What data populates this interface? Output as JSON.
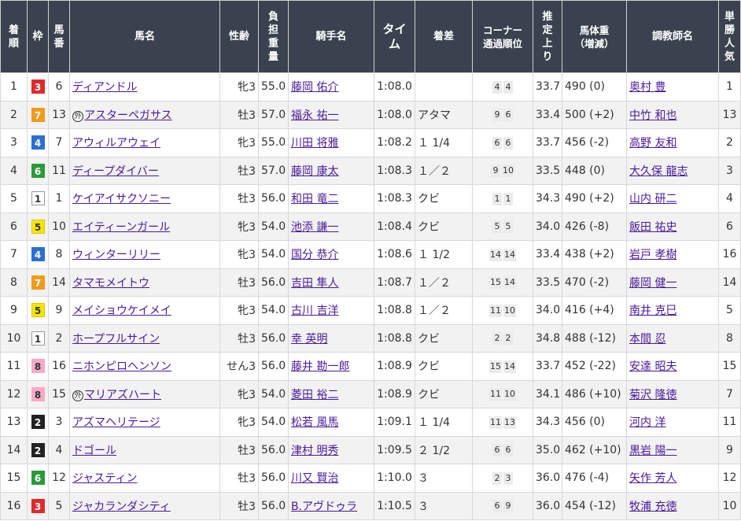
{
  "headers": {
    "rank": "着順",
    "frame": "枠",
    "num": "馬番",
    "horse": "馬名",
    "sexage": "性齢",
    "weight": "負担重量",
    "jockey": "騎手名",
    "time": "タイム",
    "margin": "着差",
    "corner": "コーナー\n通過順位",
    "last3f": "推定上り",
    "bodyweight": "馬体重\n（増減）",
    "trainer": "調教師名",
    "pop": "単勝人気"
  },
  "frame_colors": {
    "1": {
      "bg": "#ffffff",
      "fg": "#333333",
      "border": "#999999"
    },
    "2": {
      "bg": "#222222",
      "fg": "#ffffff",
      "border": "#222222"
    },
    "3": {
      "bg": "#e02a2a",
      "fg": "#ffffff",
      "border": "#e02a2a"
    },
    "4": {
      "bg": "#2a6fd6",
      "fg": "#ffffff",
      "border": "#2a6fd6"
    },
    "5": {
      "bg": "#f5e600",
      "fg": "#333333",
      "border": "#d8c800"
    },
    "6": {
      "bg": "#2a9a3a",
      "fg": "#ffffff",
      "border": "#2a9a3a"
    },
    "7": {
      "bg": "#f29a1a",
      "fg": "#ffffff",
      "border": "#f29a1a"
    },
    "8": {
      "bg": "#f7a8c8",
      "fg": "#333333",
      "border": "#f7a8c8"
    }
  },
  "gaisha_mark": "外",
  "rows": [
    {
      "rank": "1",
      "frame": "3",
      "num": "6",
      "horse": "ディアンドル",
      "gai": false,
      "sexage": "牝3",
      "weight": "55.0",
      "jockey": "藤岡 佑介",
      "time": "1:08.0",
      "margin": "",
      "c1": "4",
      "c2": "4",
      "last3f": "33.7",
      "bw": "490 (0)",
      "trainer": "奥村 豊",
      "pop": "1"
    },
    {
      "rank": "2",
      "frame": "7",
      "num": "13",
      "horse": "アスターペガサス",
      "gai": true,
      "sexage": "牡3",
      "weight": "57.0",
      "jockey": "福永 祐一",
      "time": "1:08.0",
      "margin": "アタマ",
      "c1": "9",
      "c2": "6",
      "last3f": "33.4",
      "bw": "500 (+2)",
      "trainer": "中竹 和也",
      "pop": "13"
    },
    {
      "rank": "3",
      "frame": "4",
      "num": "7",
      "horse": "アウィルアウェイ",
      "gai": false,
      "sexage": "牝3",
      "weight": "55.0",
      "jockey": "川田 将雅",
      "time": "1:08.2",
      "margin": "１ 1/4",
      "c1": "6",
      "c2": "6",
      "last3f": "33.7",
      "bw": "456 (-2)",
      "trainer": "高野 友和",
      "pop": "2"
    },
    {
      "rank": "4",
      "frame": "6",
      "num": "11",
      "horse": "ディープダイバー",
      "gai": false,
      "sexage": "牡3",
      "weight": "57.0",
      "jockey": "藤岡 康太",
      "time": "1:08.3",
      "margin": "１／２",
      "c1": "9",
      "c2": "10",
      "last3f": "33.5",
      "bw": "448 (0)",
      "trainer": "大久保 龍志",
      "pop": "3"
    },
    {
      "rank": "5",
      "frame": "1",
      "num": "1",
      "horse": "ケイアイサクソニー",
      "gai": false,
      "sexage": "牡3",
      "weight": "56.0",
      "jockey": "和田 竜二",
      "time": "1:08.3",
      "margin": "クビ",
      "c1": "1",
      "c2": "1",
      "last3f": "34.3",
      "bw": "490 (+2)",
      "trainer": "山内 研二",
      "pop": "4"
    },
    {
      "rank": "6",
      "frame": "5",
      "num": "10",
      "horse": "エイティーンガール",
      "gai": false,
      "sexage": "牝3",
      "weight": "54.0",
      "jockey": "池添 謙一",
      "time": "1:08.4",
      "margin": "クビ",
      "c1": "5",
      "c2": "5",
      "last3f": "34.0",
      "bw": "426 (-8)",
      "trainer": "飯田 祐史",
      "pop": "6"
    },
    {
      "rank": "7",
      "frame": "4",
      "num": "8",
      "horse": "ウィンターリリー",
      "gai": false,
      "sexage": "牝3",
      "weight": "54.0",
      "jockey": "国分 恭介",
      "time": "1:08.6",
      "margin": "１ 1/2",
      "c1": "14",
      "c2": "14",
      "last3f": "33.4",
      "bw": "438 (+2)",
      "trainer": "岩戸 孝樹",
      "pop": "16"
    },
    {
      "rank": "8",
      "frame": "7",
      "num": "14",
      "horse": "タマモメイトウ",
      "gai": false,
      "sexage": "牡3",
      "weight": "56.0",
      "jockey": "吉田 隼人",
      "time": "1:08.7",
      "margin": "１／２",
      "c1": "15",
      "c2": "14",
      "last3f": "33.5",
      "bw": "470 (-2)",
      "trainer": "藤岡 健一",
      "pop": "14"
    },
    {
      "rank": "9",
      "frame": "5",
      "num": "9",
      "horse": "メイショウケイメイ",
      "gai": false,
      "sexage": "牝3",
      "weight": "54.0",
      "jockey": "古川 吉洋",
      "time": "1:08.8",
      "margin": "１／２",
      "c1": "11",
      "c2": "10",
      "last3f": "34.0",
      "bw": "416 (+4)",
      "trainer": "南井 克巳",
      "pop": "5"
    },
    {
      "rank": "10",
      "frame": "1",
      "num": "2",
      "horse": "ホープフルサイン",
      "gai": false,
      "sexage": "牡3",
      "weight": "56.0",
      "jockey": "幸 英明",
      "time": "1:08.8",
      "margin": "クビ",
      "c1": "2",
      "c2": "2",
      "last3f": "34.8",
      "bw": "488 (-12)",
      "trainer": "本間 忍",
      "pop": "8"
    },
    {
      "rank": "11",
      "frame": "8",
      "num": "16",
      "horse": "ニホンピロヘンソン",
      "gai": false,
      "sexage": "せん3",
      "weight": "56.0",
      "jockey": "藤井 勘一郎",
      "time": "1:08.9",
      "margin": "クビ",
      "c1": "15",
      "c2": "14",
      "last3f": "33.7",
      "bw": "452 (-22)",
      "trainer": "安達 昭夫",
      "pop": "15"
    },
    {
      "rank": "12",
      "frame": "8",
      "num": "15",
      "horse": "マリアズハート",
      "gai": true,
      "sexage": "牝3",
      "weight": "54.0",
      "jockey": "菱田 裕二",
      "time": "1:08.9",
      "margin": "クビ",
      "c1": "11",
      "c2": "10",
      "last3f": "34.1",
      "bw": "486 (+10)",
      "trainer": "菊沢 隆徳",
      "pop": "7"
    },
    {
      "rank": "13",
      "frame": "2",
      "num": "3",
      "horse": "アズマヘリテージ",
      "gai": false,
      "sexage": "牝3",
      "weight": "54.0",
      "jockey": "松若 風馬",
      "time": "1:09.1",
      "margin": "１ 1/4",
      "c1": "11",
      "c2": "13",
      "last3f": "34.3",
      "bw": "456 (0)",
      "trainer": "河内 洋",
      "pop": "11"
    },
    {
      "rank": "14",
      "frame": "2",
      "num": "4",
      "horse": "ドゴール",
      "gai": false,
      "sexage": "牡3",
      "weight": "56.0",
      "jockey": "津村 明秀",
      "time": "1:09.5",
      "margin": "２ 1/2",
      "c1": "6",
      "c2": "6",
      "last3f": "35.0",
      "bw": "462 (+10)",
      "trainer": "黒岩 陽一",
      "pop": "9"
    },
    {
      "rank": "15",
      "frame": "6",
      "num": "12",
      "horse": "ジャスティン",
      "gai": false,
      "sexage": "牡3",
      "weight": "56.0",
      "jockey": "川又 賢治",
      "time": "1:10.0",
      "margin": "３",
      "c1": "2",
      "c2": "3",
      "last3f": "36.0",
      "bw": "476 (-4)",
      "trainer": "矢作 芳人",
      "pop": "12"
    },
    {
      "rank": "16",
      "frame": "3",
      "num": "5",
      "horse": "ジャカランダシティ",
      "gai": false,
      "sexage": "牡3",
      "weight": "56.0",
      "jockey": "B.アヴドゥラ",
      "time": "1:10.5",
      "margin": "３",
      "c1": "6",
      "c2": "9",
      "last3f": "36.0",
      "bw": "454 (-12)",
      "trainer": "牧浦 充徳",
      "pop": "10"
    }
  ]
}
